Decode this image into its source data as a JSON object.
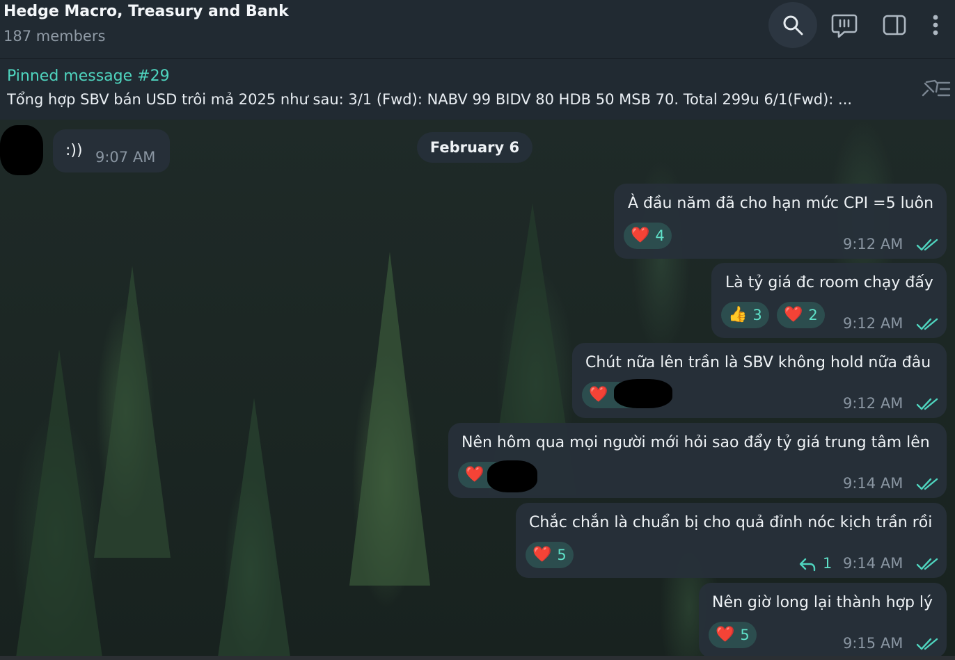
{
  "header": {
    "title": "Hedge Macro, Treasury and Bank",
    "subtitle": "187 members",
    "icons": [
      "search-icon",
      "comments-icon",
      "sidebar-icon",
      "more-icon"
    ]
  },
  "pinned": {
    "title": "Pinned message #29",
    "text": "Tổng hợp SBV bán USD trôi mả 2025 như sau: 3/1 (Fwd): NABV 99 BIDV 80 HDB 50 MSB 70. Total 299u 6/1(Fwd): ..."
  },
  "date_separator": "February 6",
  "incoming": {
    "text": ":))",
    "time": "9:07 AM"
  },
  "messages": [
    {
      "text": "À đầu năm đã cho hạn mức CPI =5 luôn",
      "time": "9:12 AM",
      "reactions": [
        {
          "emoji": "❤️",
          "count": "4"
        }
      ]
    },
    {
      "text": "Là tỷ giá đc room chạy đấy",
      "time": "9:12 AM",
      "reactions": [
        {
          "emoji": "👍",
          "count": "3"
        },
        {
          "emoji": "❤️",
          "count": "2"
        }
      ]
    },
    {
      "text": "Chút nữa lên trần là SBV không hold nữa đâu",
      "time": "9:12 AM",
      "reactions": [
        {
          "emoji": "❤️",
          "count": ""
        }
      ]
    },
    {
      "text": "Nên hôm qua mọi người mới hỏi sao đẩy tỷ giá trung tâm lên",
      "time": "9:14 AM",
      "reactions": [
        {
          "emoji": "❤️",
          "count": ""
        }
      ]
    },
    {
      "text": "Chắc chắn là chuẩn bị cho quả đỉnh nóc kịch trần rồi",
      "time": "9:14 AM",
      "reply_count": "1",
      "reactions": [
        {
          "emoji": "❤️",
          "count": "5"
        }
      ]
    },
    {
      "text": "Nên giờ long lại thành hợp lý",
      "time": "9:15 AM",
      "reactions": [
        {
          "emoji": "❤️",
          "count": "5"
        }
      ]
    }
  ],
  "colors": {
    "accent": "#4fd5bf",
    "bubble": "#263039",
    "header": "#212a32"
  }
}
